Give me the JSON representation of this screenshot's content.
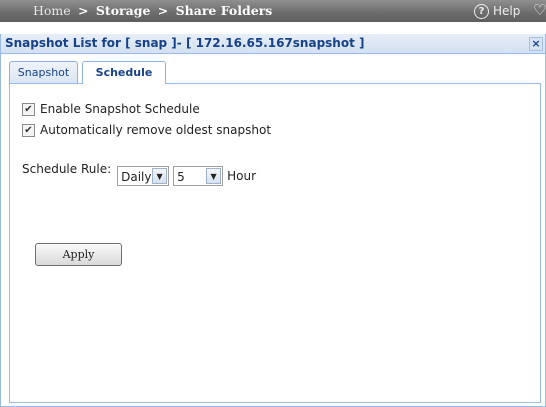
{
  "breadcrumb": {
    "home": "Home",
    "separator": ">",
    "storage": "Storage",
    "current": "Share Folders"
  },
  "help": {
    "icon": "help-circle-icon",
    "label": "Help"
  },
  "dialog": {
    "title": "Snapshot List for [ snap ]- [ 172.16.65.167snapshot ]",
    "close_glyph": "×"
  },
  "tabs": [
    {
      "label": "Snapshot",
      "active": false
    },
    {
      "label": "Schedule",
      "active": true
    }
  ],
  "schedule": {
    "enable_label": "Enable Snapshot Schedule",
    "enable_checked": true,
    "remove_oldest_label": "Automatically remove oldest snapshot",
    "remove_oldest_checked": true,
    "rule_label": "Schedule Rule:",
    "frequency_value": "Daily",
    "hour_value": "5",
    "hour_unit": "Hour",
    "apply_label": "Apply"
  },
  "colors": {
    "title_text": "#15428b",
    "panel_border": "#99bbe8",
    "topbar": "#6e6e6e"
  }
}
